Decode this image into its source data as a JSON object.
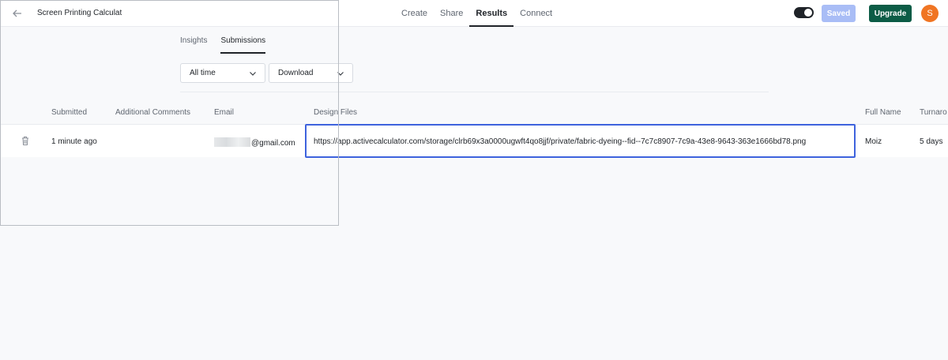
{
  "header": {
    "title": "Screen Printing Calculat",
    "nav": [
      {
        "label": "Create",
        "active": false
      },
      {
        "label": "Share",
        "active": false
      },
      {
        "label": "Results",
        "active": true
      },
      {
        "label": "Connect",
        "active": false
      }
    ],
    "saved_label": "Saved",
    "upgrade_label": "Upgrade",
    "avatar_initial": "S",
    "colors": {
      "upgrade": "#0c5c46",
      "saved": "#a9bdf6",
      "avatar": "#f07523",
      "selection": "#3e63dd"
    }
  },
  "subtabs": [
    {
      "label": "Insights",
      "active": false
    },
    {
      "label": "Submissions",
      "active": true
    }
  ],
  "filters": {
    "time_range": "All time",
    "download": "Download"
  },
  "table": {
    "columns": [
      "Submitted",
      "Additional Comments",
      "Email",
      "Design Files",
      "Full Name",
      "Turnaro"
    ],
    "rows": [
      {
        "submitted": "1 minute ago",
        "comments": "",
        "email": "@gmail.com",
        "design_files": "https://app.activecalculator.com/storage/clrb69x3a0000ugwft4qo8jjf/private/fabric-dyeing--fid--7c7c8907-7c9a-43e8-9643-363e1666bd78.png",
        "full_name": "Moiz",
        "turnaround": "5 days"
      }
    ]
  }
}
